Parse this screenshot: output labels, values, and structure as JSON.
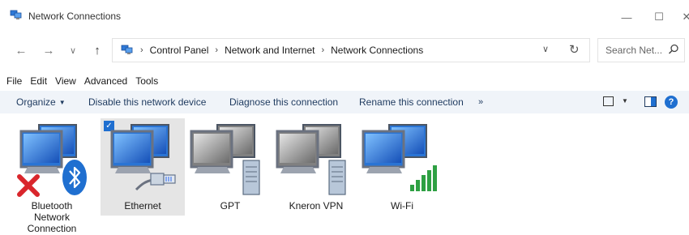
{
  "window": {
    "title": "Network Connections",
    "controls": {
      "minimize": "—",
      "maximize": "☐",
      "close": "✕"
    }
  },
  "navigation": {
    "back": "←",
    "forward": "→",
    "recent": "∨",
    "up": "↑",
    "breadcrumb": [
      "Control Panel",
      "Network and Internet",
      "Network Connections"
    ],
    "separator": "›",
    "dropdown": "∨",
    "refresh": "↻",
    "search_placeholder": "Search Net..."
  },
  "menu": [
    "File",
    "Edit",
    "View",
    "Advanced",
    "Tools"
  ],
  "commands": {
    "organize": "Organize",
    "disable": "Disable this network device",
    "diagnose": "Diagnose this connection",
    "rename": "Rename this connection",
    "more": "»",
    "help": "?"
  },
  "connections": [
    {
      "name": "Bluetooth Network Connection",
      "lines": [
        "Bluetooth",
        "Network",
        "Connection"
      ],
      "icon": "bluetooth-icon",
      "status": "disabled",
      "selected": false
    },
    {
      "name": "Ethernet",
      "lines": [
        "Ethernet"
      ],
      "icon": "ethernet-cable-icon",
      "status": "connected",
      "selected": true
    },
    {
      "name": "GPT",
      "lines": [
        "GPT"
      ],
      "icon": "server-icon",
      "status": "disconnected",
      "selected": false
    },
    {
      "name": "Kneron VPN",
      "lines": [
        "Kneron VPN"
      ],
      "icon": "server-icon",
      "status": "disconnected",
      "selected": false
    },
    {
      "name": "Wi-Fi",
      "lines": [
        "Wi-Fi"
      ],
      "icon": "wifi-signal-icon",
      "status": "connected",
      "selected": false
    }
  ],
  "colors": {
    "accent": "#1f6fd0",
    "command_bar": "#f0f4f9",
    "selected_item": "#e5e5e5",
    "error_red": "#d9262c",
    "signal_green": "#2ea043"
  }
}
